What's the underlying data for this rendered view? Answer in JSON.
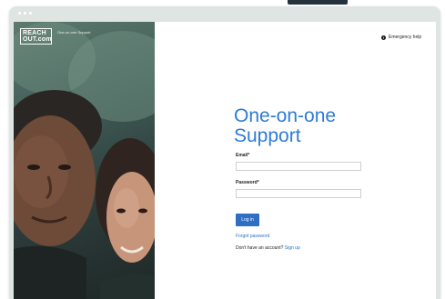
{
  "logo": {
    "line1": "REACH",
    "line2": "OUT.com"
  },
  "tagline": "One-on-one Support",
  "header": {
    "emergency_label": "Emergency help",
    "emergency_icon": "info-icon"
  },
  "form": {
    "title": "One-on-one Support",
    "email_label": "Email*",
    "email_value": "",
    "password_label": "Password*",
    "password_value": "",
    "login_label": "Log in",
    "forgot_label": "Forgot password",
    "account_prompt": "Don't have an account?",
    "signup_label": "Sign up"
  },
  "colors": {
    "accent": "#2d7bd6",
    "button": "#2e6fc4",
    "frame": "#dfe5e3"
  }
}
